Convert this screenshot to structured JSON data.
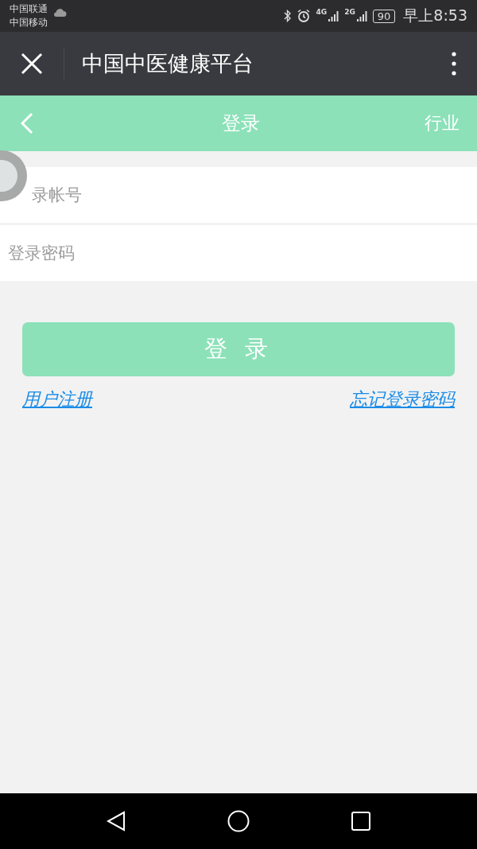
{
  "status_bar": {
    "carriers": [
      "中国联通",
      "中国移动"
    ],
    "network_1": "4G",
    "network_2": "2G",
    "battery": "90",
    "time": "早上8:53"
  },
  "window": {
    "title": "中国中医健康平台"
  },
  "header": {
    "title": "登录",
    "right_action": "行业"
  },
  "form": {
    "fields": [
      {
        "placeholder": "录帐号"
      },
      {
        "placeholder": "登录密码"
      }
    ],
    "submit": "登 录",
    "links": [
      "用户注册",
      "忘记登录密码"
    ]
  }
}
